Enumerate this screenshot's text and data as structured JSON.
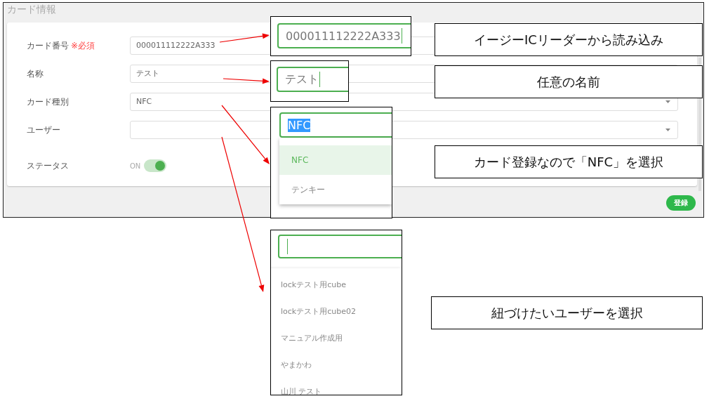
{
  "window": {
    "title": "カード情報"
  },
  "form": {
    "fields": [
      {
        "kind": "text",
        "label": "カード番号",
        "required_mark": "※必須",
        "value": "000011112222A333"
      },
      {
        "kind": "text",
        "label": "名称",
        "value": "テスト"
      },
      {
        "kind": "select",
        "label": "カード種別",
        "value": "NFC"
      },
      {
        "kind": "select",
        "label": "ユーザー"
      },
      {
        "kind": "toggle",
        "label": "ステータス",
        "state_label": "ON",
        "on": true
      }
    ]
  },
  "submit_button": "登録",
  "insets": [
    {
      "kind": "input",
      "value": "000011112222A333"
    },
    {
      "kind": "input",
      "value": "テスト"
    },
    {
      "kind": "select",
      "value": "NFC",
      "options": [
        {
          "label": "NFC",
          "selected": true
        },
        {
          "label": "テンキー",
          "selected": false
        }
      ]
    },
    {
      "kind": "search",
      "options": [
        {
          "label": "lockテスト用cube",
          "selected": false
        },
        {
          "label": "lockテスト用cube02",
          "selected": false
        },
        {
          "label": "マニュアル作成用",
          "selected": false
        },
        {
          "label": "やまかわ",
          "selected": false
        },
        {
          "label": "山川 テスト",
          "selected": false
        }
      ]
    }
  ],
  "callouts": [
    "イージーICリーダーから読み込み",
    "任意の名前",
    "カード登録なので「NFC」を選択",
    "紐づけたいユーザーを選択"
  ]
}
